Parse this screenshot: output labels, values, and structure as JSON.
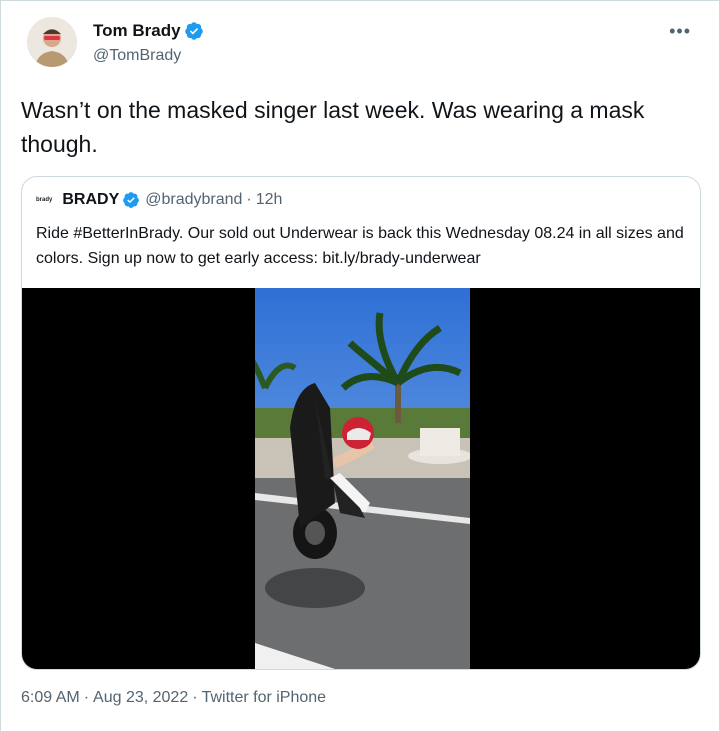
{
  "author": {
    "name": "Tom Brady",
    "handle": "@TomBrady",
    "verified": true,
    "avatar_icon": "person-avatar"
  },
  "more_icon": "ellipsis-icon",
  "tweet": {
    "text": "Wasn’t on the masked singer last week. Was wearing a mask though."
  },
  "quoted_tweet": {
    "logo_text": "brady",
    "name": "BRADY",
    "verified": true,
    "handle": "@bradybrand",
    "separator": "·",
    "time": "12h",
    "text": "Ride #BetterInBrady. Our sold out Underwear is back this Wednesday 08.24 in all sizes and colors. Sign up now to get early access: bit.ly/brady-underwear",
    "media": "video-thumbnail"
  },
  "footer": {
    "time": "6:09 AM",
    "sep1": "·",
    "date": "Aug 23, 2022",
    "sep2": "·",
    "source": "Twitter for iPhone"
  },
  "colors": {
    "verified_blue": "#1d9bf0",
    "secondary_text": "#536471",
    "border": "#cfd9de"
  }
}
